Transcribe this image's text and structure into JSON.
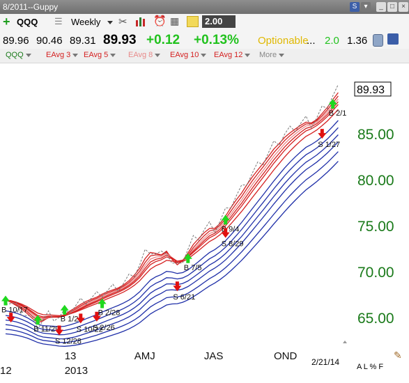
{
  "window": {
    "title": "8/2011--Guppy"
  },
  "toolbar": {
    "symbol": "QQQ",
    "period": "Weekly",
    "value_box": "2.00"
  },
  "quote": {
    "open": "89.96",
    "high": "90.46",
    "low": "89.31",
    "last": "89.93",
    "change": "+0.12",
    "change_pct": "+0.13%",
    "optionable": "Optionable",
    "ellipsis": "...",
    "v1": "2.0",
    "v2": "1.36"
  },
  "studies": [
    {
      "label": "QQQ",
      "color": "#1a7a1a"
    },
    {
      "label": "EAvg 3",
      "color": "#d42020"
    },
    {
      "label": "EAvg 5",
      "color": "#d42020"
    },
    {
      "label": "EAvg 8",
      "color": "#e88a8a"
    },
    {
      "label": "EAvg 10",
      "color": "#d42020"
    },
    {
      "label": "EAvg 12",
      "color": "#d42020"
    },
    {
      "label": "More",
      "color": "#888888"
    }
  ],
  "chart_data": {
    "type": "line",
    "price_label": "89.93",
    "y_ticks": [
      {
        "label": "85.00",
        "value": 85
      },
      {
        "label": "80.00",
        "value": 80
      },
      {
        "label": "75.00",
        "value": 75
      },
      {
        "label": "70.00",
        "value": 70
      },
      {
        "label": "65.00",
        "value": 65
      }
    ],
    "x_labels": [
      {
        "label": "12",
        "row": 2,
        "week": -7
      },
      {
        "label": "13",
        "row": 1,
        "week": 11
      },
      {
        "label": "2013",
        "row": 2,
        "week": 11
      },
      {
        "label": "AMJ",
        "row": 1,
        "week": 24
      },
      {
        "label": "JAS",
        "row": 1,
        "week": 37
      },
      {
        "label": "OND",
        "row": 1,
        "week": 50
      }
    ],
    "date_label": "2/21/14",
    "close_series": [
      67,
      66.6,
      66.2,
      65.8,
      65.3,
      64.7,
      64.3,
      64.8,
      65.3,
      65.2,
      65.1,
      65.5,
      66,
      66.3,
      66.7,
      67,
      67.2,
      67.4,
      67.8,
      68,
      68.2,
      68.4,
      68.8,
      69.3,
      70,
      70.8,
      72,
      72.5,
      72,
      71.8,
      72.5,
      71,
      70.5,
      71.5,
      72.5,
      73.5,
      74,
      74.6,
      75,
      74.8,
      75.6,
      76.5,
      77.5,
      78.3,
      79,
      80,
      80.8,
      81.5,
      82.2,
      83,
      83.8,
      84.3,
      85,
      85.4,
      85.8,
      86.2,
      86.5,
      86.2,
      86.8,
      87.6,
      88.3,
      89.2,
      89.93
    ],
    "signals": [
      {
        "type": "B",
        "label": "B 10/17",
        "week": 0,
        "price": 66.4
      },
      {
        "type": "S",
        "label": "",
        "week": 1,
        "price": 65.6
      },
      {
        "type": "B",
        "label": "B 11/29",
        "week": 6,
        "price": 64.3
      },
      {
        "type": "S",
        "label": "S 12/28",
        "week": 10,
        "price": 64.2
      },
      {
        "type": "B",
        "label": "B 1/2",
        "week": 11,
        "price": 65.4
      },
      {
        "type": "S",
        "label": "S 10/22",
        "week": 14,
        "price": 65.5
      },
      {
        "type": "B",
        "label": "B 2/28",
        "week": 18,
        "price": 66.1
      },
      {
        "type": "S",
        "label": "S 2/26",
        "week": 17,
        "price": 65.7
      },
      {
        "type": "B",
        "label": "B 7/5",
        "week": 34,
        "price": 71.0
      },
      {
        "type": "S",
        "label": "S 6/21",
        "week": 32,
        "price": 69.0
      },
      {
        "type": "B",
        "label": "B 9/4",
        "week": 41,
        "price": 75.2
      },
      {
        "type": "S",
        "label": "S 8/29",
        "week": 41,
        "price": 74.8
      },
      {
        "type": "B",
        "label": "B 2/1",
        "week": 61,
        "price": 87.8
      },
      {
        "type": "S",
        "label": "S 1/27",
        "week": 59,
        "price": 85.6
      }
    ]
  },
  "footer": {
    "date": "2/21/14",
    "scale": "A L % F"
  }
}
